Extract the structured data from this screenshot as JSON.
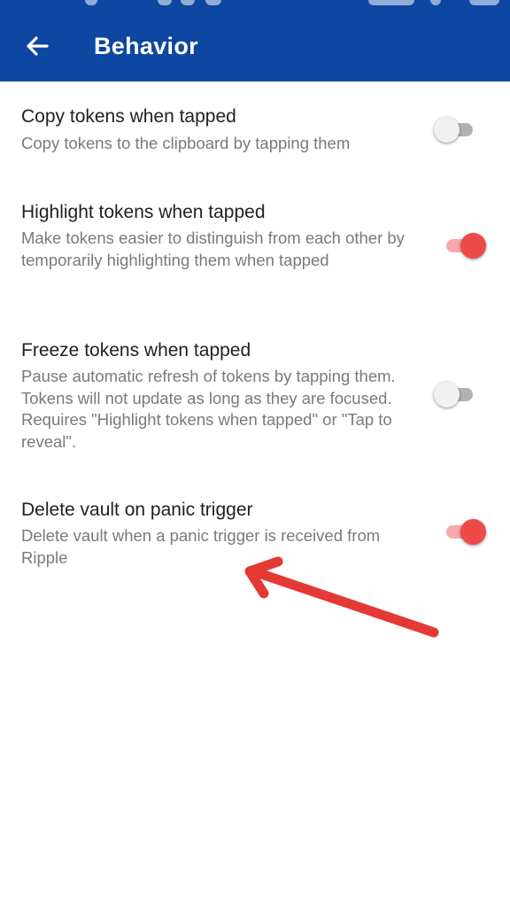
{
  "header": {
    "title": "Behavior",
    "background_color": "#0d47a1",
    "back_icon": "arrow-left-icon"
  },
  "settings": [
    {
      "title": "Copy tokens when tapped",
      "description": "Copy tokens to the clipboard by tapping them",
      "enabled": false
    },
    {
      "title": "Highlight tokens when tapped",
      "description": "Make tokens easier to distinguish from each other by temporarily highlighting them when tapped",
      "enabled": true
    },
    {
      "title": "Freeze tokens when tapped",
      "description": "Pause automatic refresh of tokens by tapping them. Tokens will not update as long as they are focused. Requires \"Highlight tokens when tapped\" or \"Tap to reveal\".",
      "enabled": false
    },
    {
      "title": "Delete vault on panic trigger",
      "description": "Delete vault when a panic trigger is received from Ripple",
      "enabled": true
    }
  ],
  "colors": {
    "switch_on_thumb": "#ee4a4a",
    "switch_on_track": "#f7a8a8",
    "switch_off_thumb": "#f1f1f1",
    "switch_off_track": "#b2b2b2",
    "annotation_arrow": "#e53935"
  },
  "annotation": {
    "icon": "red-arrow-annotation"
  }
}
